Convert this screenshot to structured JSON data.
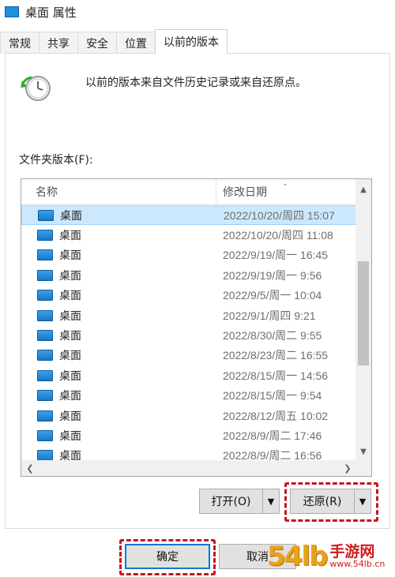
{
  "window": {
    "title": "桌面 属性"
  },
  "tabs": [
    {
      "label": "常规"
    },
    {
      "label": "共享"
    },
    {
      "label": "安全"
    },
    {
      "label": "位置"
    },
    {
      "label": "以前的版本",
      "active": true
    }
  ],
  "info": {
    "text": "以前的版本来自文件历史记录或来自还原点。",
    "icon": "file-history-clock-icon"
  },
  "list": {
    "label": "文件夹版本(F):",
    "columns": {
      "name": "名称",
      "date": "修改日期"
    },
    "rows": [
      {
        "name": "桌面",
        "date": "2022/10/20/周四 15:07",
        "selected": true
      },
      {
        "name": "桌面",
        "date": "2022/10/20/周四 11:08"
      },
      {
        "name": "桌面",
        "date": "2022/9/19/周一 16:45"
      },
      {
        "name": "桌面",
        "date": "2022/9/19/周一 9:56"
      },
      {
        "name": "桌面",
        "date": "2022/9/5/周一 10:04"
      },
      {
        "name": "桌面",
        "date": "2022/9/1/周四 9:21"
      },
      {
        "name": "桌面",
        "date": "2022/8/30/周二 9:55"
      },
      {
        "name": "桌面",
        "date": "2022/8/23/周二 16:55"
      },
      {
        "name": "桌面",
        "date": "2022/8/15/周一 14:56"
      },
      {
        "name": "桌面",
        "date": "2022/8/15/周一 9:54"
      },
      {
        "name": "桌面",
        "date": "2022/8/12/周五 10:02"
      },
      {
        "name": "桌面",
        "date": "2022/8/9/周二 17:46"
      },
      {
        "name": "桌面",
        "date": "2022/8/9/周二 16:56"
      }
    ]
  },
  "actions": {
    "open": "打开(O)",
    "restore": "还原(R)"
  },
  "footer": {
    "ok": "确定",
    "cancel": "取消"
  },
  "watermark": {
    "number": "54lb",
    "site_name": "手游网",
    "url": "www.54lb.cn"
  },
  "colors": {
    "highlight": "#c8161d",
    "selection": "#cce8ff",
    "accent": "#0078d7"
  }
}
